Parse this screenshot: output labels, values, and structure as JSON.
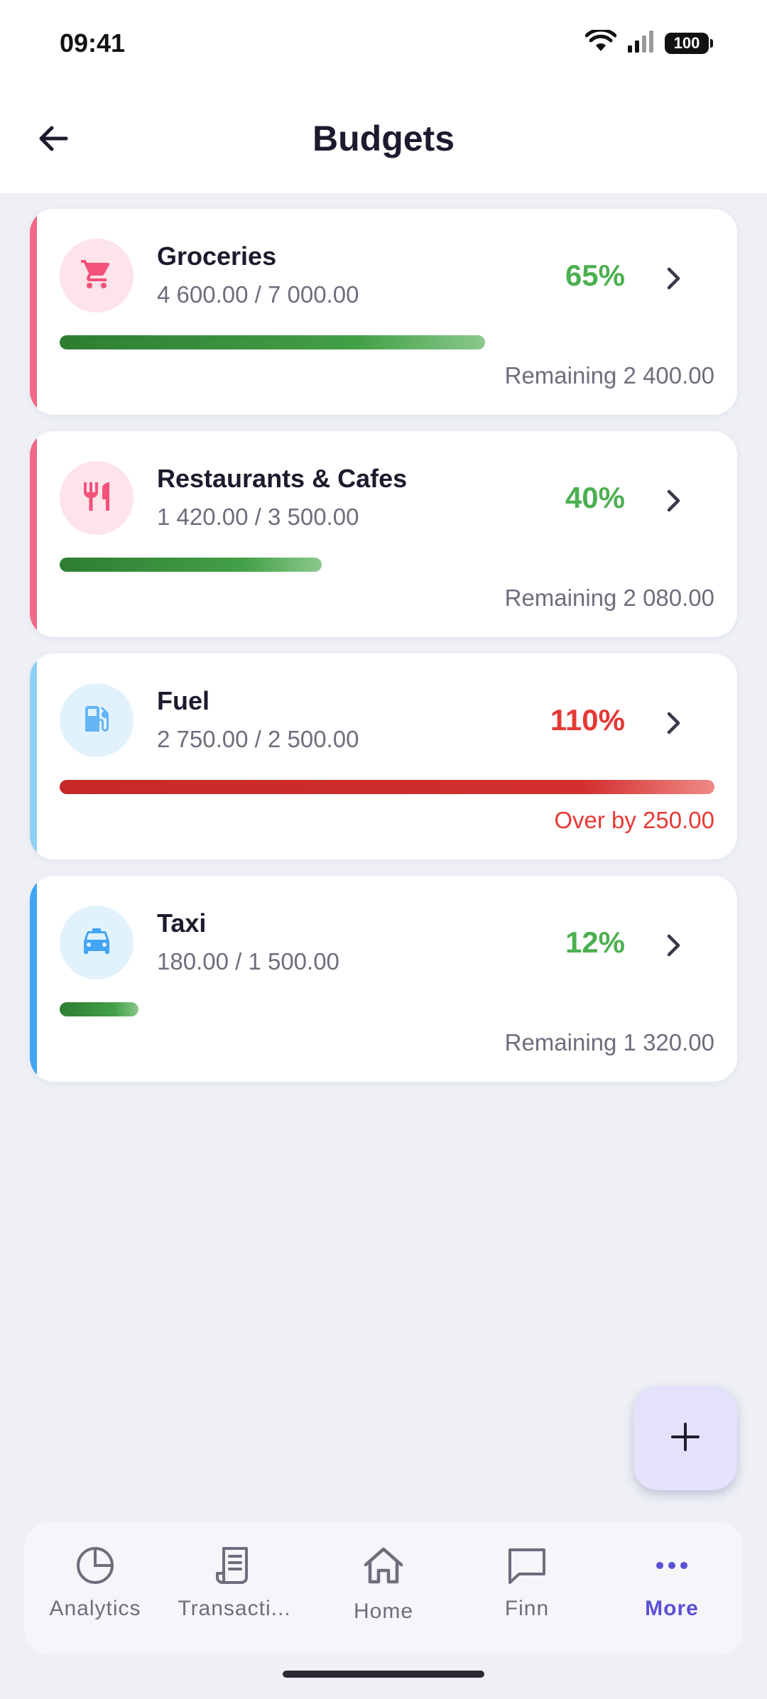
{
  "status_bar": {
    "time": "09:41",
    "battery": "100"
  },
  "header": {
    "title": "Budgets"
  },
  "budgets": [
    {
      "name": "Groceries",
      "amount": "4 600.00 / 7 000.00",
      "percent": "65%",
      "progress": 0.65,
      "remaining": "Remaining 2 400.00",
      "status": "ok",
      "icon": "cart-icon",
      "accent_color": "#f06886",
      "icon_bg": "#fde3ea",
      "icon_color": "#f25279",
      "percent_color": "#4caf50"
    },
    {
      "name": "Restaurants & Cafes",
      "amount": "1 420.00 / 3 500.00",
      "percent": "40%",
      "progress": 0.4,
      "remaining": "Remaining 2 080.00",
      "status": "ok",
      "icon": "fork-knife-icon",
      "accent_color": "#f06886",
      "icon_bg": "#fde3ea",
      "icon_color": "#f25279",
      "percent_color": "#4caf50"
    },
    {
      "name": "Fuel",
      "amount": "2 750.00 / 2 500.00",
      "percent": "110%",
      "progress": 1.0,
      "remaining": "Over by 250.00",
      "status": "over",
      "icon": "fuel-pump-icon",
      "accent_color": "#8fd0f5",
      "icon_bg": "#e1f2fd",
      "icon_color": "#64b5f6",
      "percent_color": "#e53935"
    },
    {
      "name": "Taxi",
      "amount": "180.00 / 1 500.00",
      "percent": "12%",
      "progress": 0.12,
      "remaining": "Remaining 1 320.00",
      "status": "ok",
      "icon": "taxi-icon",
      "accent_color": "#42a5f5",
      "icon_bg": "#e1f2fd",
      "icon_color": "#42a5f5",
      "percent_color": "#4caf50"
    }
  ],
  "fab": {
    "icon": "plus-icon"
  },
  "bottom_nav": {
    "active_color": "#5b4fd6",
    "items": [
      {
        "label": "Analytics",
        "icon": "pie-chart-icon",
        "active": false
      },
      {
        "label": "Transacti...",
        "icon": "receipt-icon",
        "active": false
      },
      {
        "label": "Home",
        "icon": "home-icon",
        "active": false
      },
      {
        "label": "Finn",
        "icon": "chat-icon",
        "active": false
      },
      {
        "label": "More",
        "icon": "more-dots-icon",
        "active": true
      }
    ]
  }
}
